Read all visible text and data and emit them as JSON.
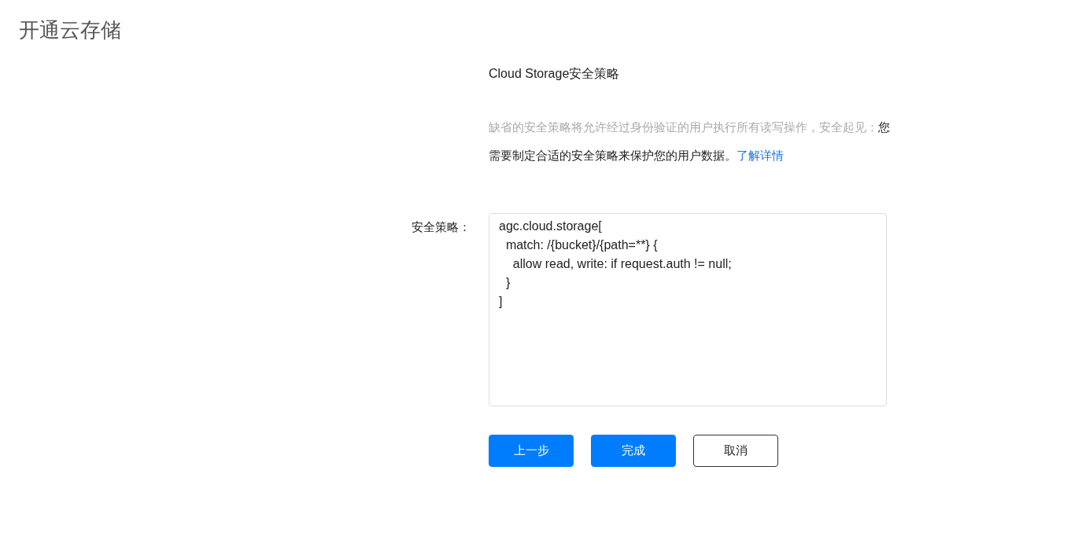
{
  "page": {
    "title": "开通云存储"
  },
  "section": {
    "heading": "Cloud Storage安全策略",
    "notice": {
      "muted": "缺省的安全策略将允许经过身份验证的用户执行所有读写操作，安全起见：",
      "main": "您需要制定合适的安全策略来保护您的用户数据。",
      "link": "了解详情"
    }
  },
  "policy": {
    "label": "安全策略：",
    "value": "agc.cloud.storage[\n  match: /{bucket}/{path=**} {\n    allow read, write: if request.auth != null;\n  }\n]"
  },
  "buttons": [
    {
      "label": "上一步",
      "kind": "primary"
    },
    {
      "label": "完成",
      "kind": "primary"
    },
    {
      "label": "取消",
      "kind": "outline"
    }
  ]
}
